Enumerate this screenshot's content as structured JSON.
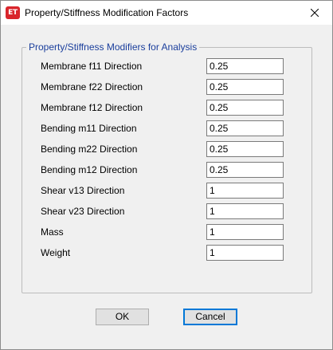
{
  "window": {
    "app_icon_text": "ET",
    "title": "Property/Stiffness Modification Factors",
    "close_icon": "close-icon"
  },
  "group": {
    "legend": "Property/Stiffness Modifiers for Analysis",
    "rows": [
      {
        "label": "Membrane f11 Direction",
        "value": "0.25"
      },
      {
        "label": "Membrane f22 Direction",
        "value": "0.25"
      },
      {
        "label": "Membrane f12 Direction",
        "value": "0.25"
      },
      {
        "label": "Bending m11 Direction",
        "value": "0.25"
      },
      {
        "label": "Bending m22 Direction",
        "value": "0.25"
      },
      {
        "label": "Bending m12 Direction",
        "value": "0.25"
      },
      {
        "label": "Shear v13 Direction",
        "value": "1"
      },
      {
        "label": "Shear v23 Direction",
        "value": "1"
      },
      {
        "label": "Mass",
        "value": "1"
      },
      {
        "label": "Weight",
        "value": "1"
      }
    ]
  },
  "buttons": {
    "ok_label": "OK",
    "cancel_label": "Cancel"
  },
  "colors": {
    "legend_text": "#1a3e9c",
    "app_icon_bg": "#d9262c",
    "default_button_border": "#0078d7"
  }
}
